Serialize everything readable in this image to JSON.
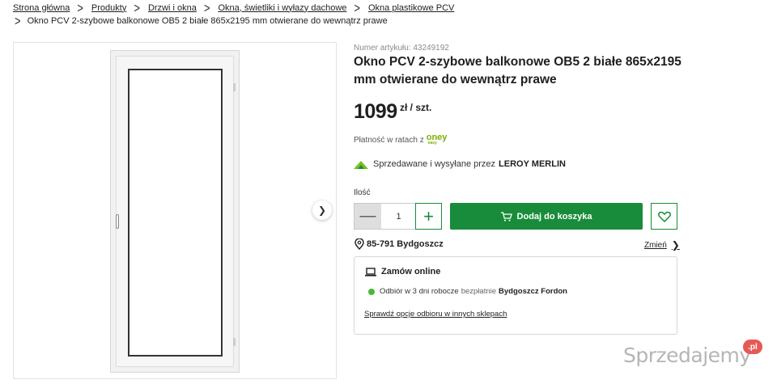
{
  "breadcrumb": {
    "items": [
      "Strona główna",
      "Produkty",
      "Drzwi i okna",
      "Okna, świetliki i wyłazy dachowe",
      "Okna plastikowe PCV"
    ],
    "current": "Okno PCV 2-szybowe balkonowe OB5 2 białe 865x2195 mm otwierane do wewnątrz prawe"
  },
  "product": {
    "article_number": "Numer artykułu: 43249192",
    "title": "Okno PCV 2-szybowe balkonowe OB5 2 białe 865x2195 mm otwierane do wewnątrz prawe",
    "price": "1099",
    "price_unit": "zł / szt.",
    "installments_label": "Płatność w ratach z",
    "installments_brand": "oney",
    "installments_brand_sub": "easy",
    "seller_label": "Sprzedawane i wysyłane przez",
    "seller_name": "LEROY MERLIN"
  },
  "purchase": {
    "quantity_label": "Ilość",
    "quantity": "1",
    "add_to_cart": "Dodaj do koszyka"
  },
  "location": {
    "postal": "85-791 Bydgoszcz",
    "change_label": "Zmień"
  },
  "order_box": {
    "title": "Zamów online",
    "pickup_text": "Odbiór w 3 dni robocze",
    "pickup_free": "bezpłatnie",
    "pickup_store": "Bydgoszcz Fordon",
    "other_stores_link": "Sprawdź opcje odbioru w innych sklepach"
  },
  "watermark": {
    "text": "Sprzedajemy",
    "suffix": ".pl"
  },
  "colors": {
    "brand_green": "#188c3a",
    "available_dot": "#49b83b",
    "oney_green": "#7ab000"
  }
}
